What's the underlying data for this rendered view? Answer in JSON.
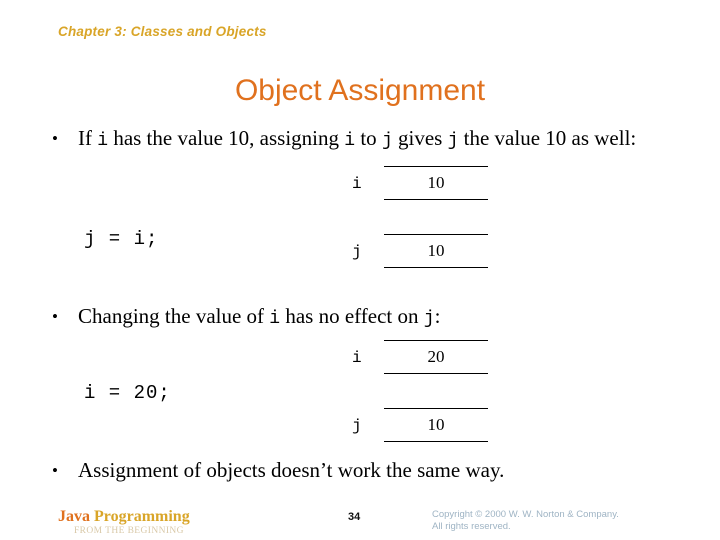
{
  "slide": {
    "chapter_header": "Chapter 3: Classes and Objects",
    "title": "Object Assignment",
    "background_color": "#FFFFFF"
  },
  "colors": {
    "header_gold": "#D9A528",
    "title_orange": "#E0711E",
    "body_black": "#000000",
    "footer_sub_tan": "#D9C9A8",
    "copyright_gray": "#9FB4C4"
  },
  "bullets": [
    {
      "marker": "•",
      "segments": [
        {
          "kind": "text",
          "value": "If "
        },
        {
          "kind": "code",
          "value": "i"
        },
        {
          "kind": "text",
          "value": " has the value 10, assigning "
        },
        {
          "kind": "code",
          "value": "i"
        },
        {
          "kind": "text",
          "value": " to "
        },
        {
          "kind": "code",
          "value": "j"
        },
        {
          "kind": "text",
          "value": " gives "
        },
        {
          "kind": "code",
          "value": "j"
        },
        {
          "kind": "text",
          "value": " the value 10 as well:"
        }
      ],
      "plain": "If i has the value 10, assigning i to j gives j the value 10 as well:"
    },
    {
      "marker": "•",
      "segments": [
        {
          "kind": "text",
          "value": "Changing the value of "
        },
        {
          "kind": "code",
          "value": "i"
        },
        {
          "kind": "text",
          "value": " has no effect on "
        },
        {
          "kind": "code",
          "value": "j"
        },
        {
          "kind": "text",
          "value": ":"
        }
      ],
      "plain": "Changing the value of i has no effect on j:"
    },
    {
      "marker": "•",
      "segments": [
        {
          "kind": "text",
          "value": "Assignment of objects doesn’t work the same way."
        }
      ],
      "plain": "Assignment of objects doesn’t work the same way."
    }
  ],
  "code_lines": [
    {
      "text": "j = i;"
    },
    {
      "text": "i = 20;"
    }
  ],
  "diagrams": [
    {
      "id": "after-assignment",
      "variables": [
        {
          "label": "i",
          "value": "10"
        },
        {
          "label": "j",
          "value": "10"
        }
      ]
    },
    {
      "id": "after-change",
      "variables": [
        {
          "label": "i",
          "value": "20"
        },
        {
          "label": "j",
          "value": "10"
        }
      ]
    }
  ],
  "footer": {
    "brand_word_1": "Java",
    "brand_word_2": "Programming",
    "subtitle": "FROM THE BEGINNING",
    "page_number": "34",
    "copyright_line_1": "Copyright © 2000 W. W. Norton & Company.",
    "copyright_line_2": "All rights reserved."
  }
}
